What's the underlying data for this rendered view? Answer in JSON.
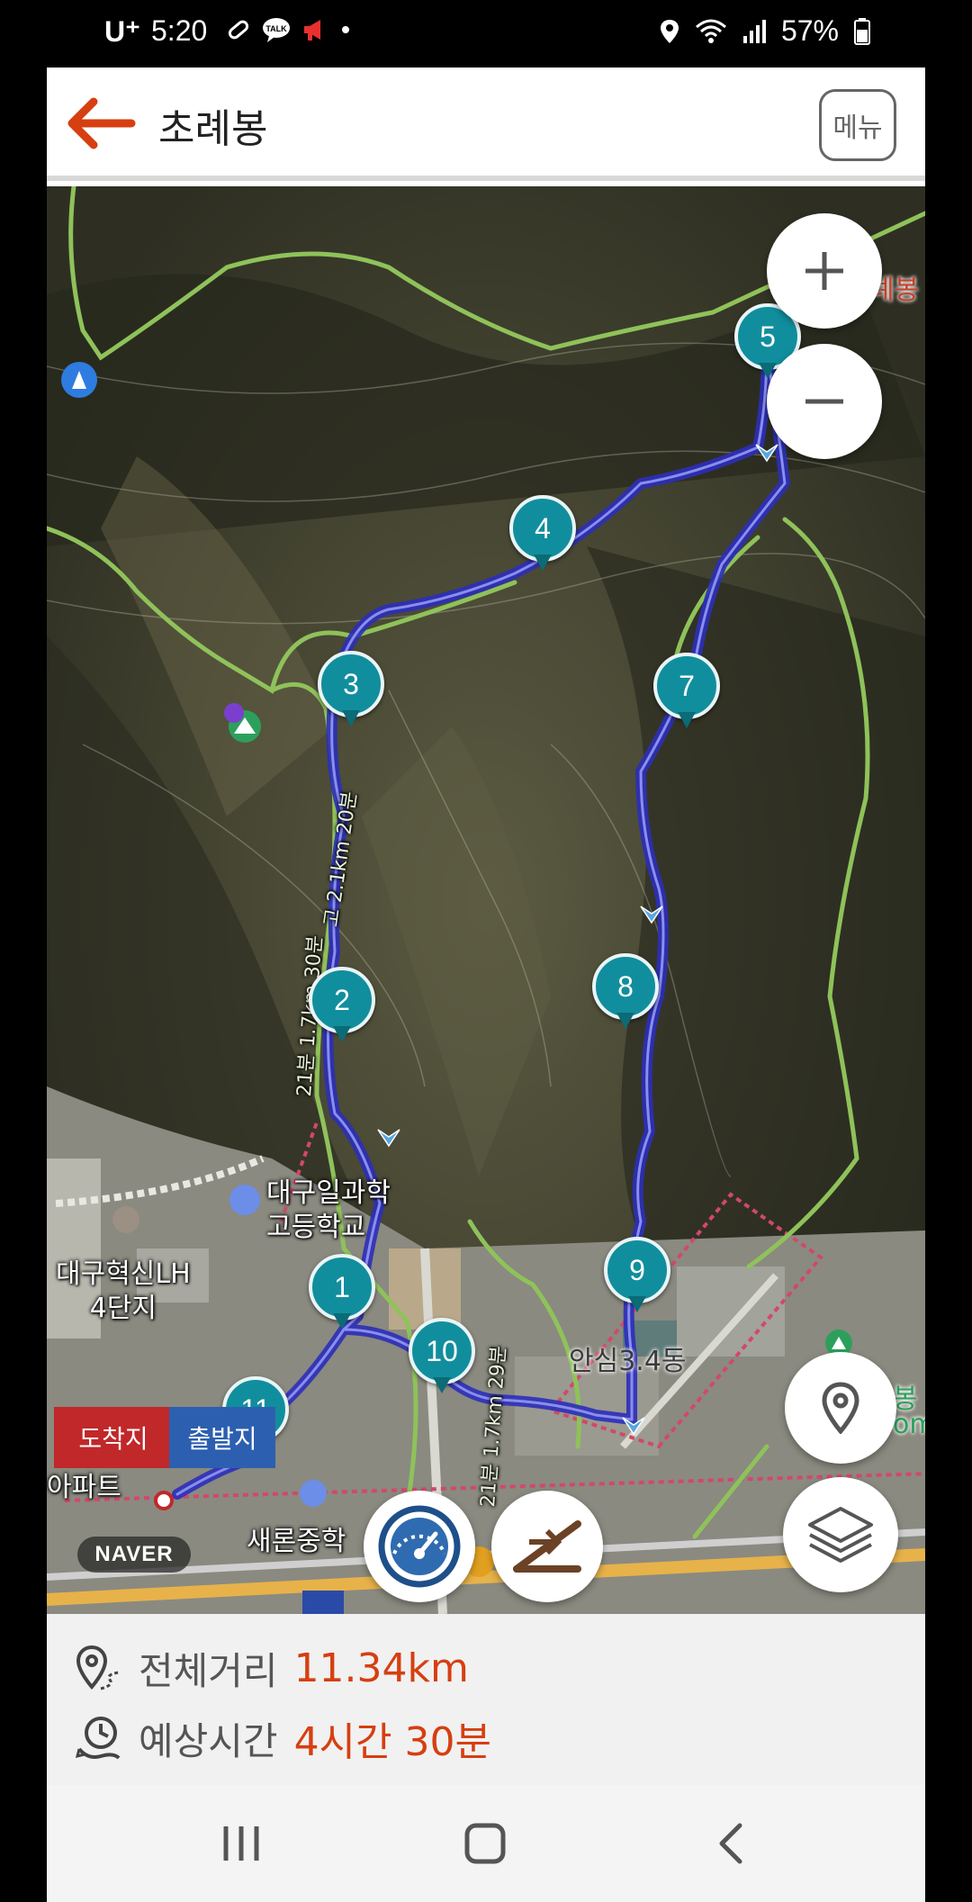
{
  "status_bar": {
    "carrier": "U⁺",
    "time": "5:20",
    "battery": "57%",
    "icons_left": [
      "pill-icon",
      "talk-icon",
      "megaphone-icon",
      "dot-icon"
    ],
    "icons_right": [
      "location-icon",
      "wifi-icon",
      "signal-icon",
      "battery-icon"
    ]
  },
  "header": {
    "title": "초례봉",
    "menu_label": "메뉴"
  },
  "map": {
    "markers": [
      "1",
      "2",
      "3",
      "4",
      "5",
      "7",
      "8",
      "9",
      "10",
      "11"
    ],
    "labels": {
      "school": "대구일과학\n고등학교",
      "apartment": "대구혁신LH\n4단지",
      "middle_school": "새론중학",
      "district": "안심3.4동",
      "apartment2": "아파트",
      "peak_right": "례봉",
      "right_edge_a": "봉",
      "right_edge_b": "om",
      "trail_a": "21분 1.7km 30분",
      "trail_b": "21분 1.7km 29분",
      "trail_c": "고 2.1km 20분"
    },
    "flags": {
      "arrive": "도착지",
      "depart": "출발지"
    },
    "watermark": "NAVER",
    "route_color": "#3b3fd0",
    "trail_color": "#8fc25a"
  },
  "info": {
    "distance_label": "전체거리",
    "distance_value": "11.34km",
    "time_label": "예상시간",
    "time_value": "4시간 30분",
    "accent_color": "#d63f10"
  }
}
